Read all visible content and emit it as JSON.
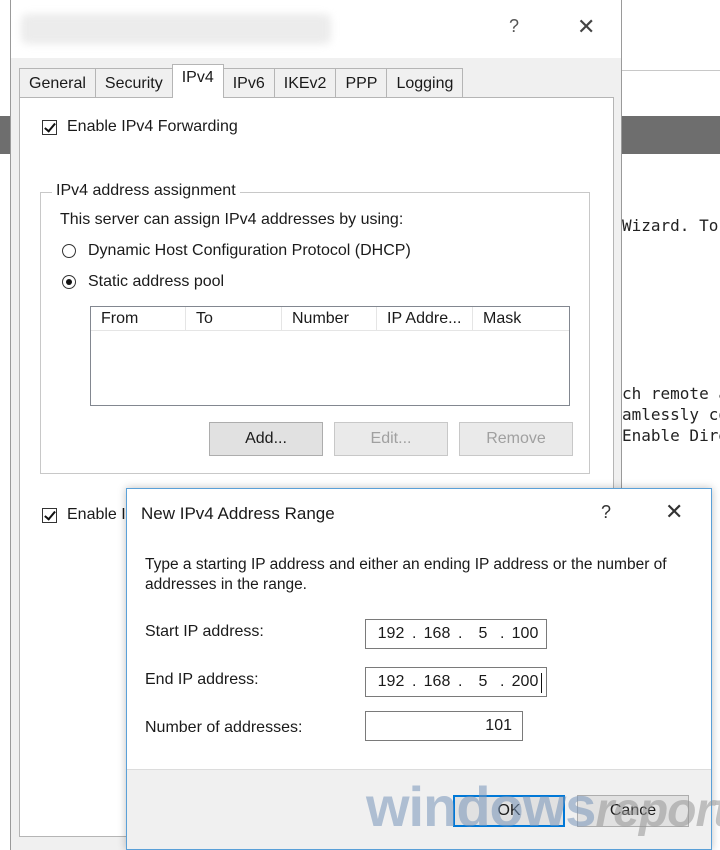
{
  "background_window": {
    "lines": [
      "Wizard. To",
      "ch remote a",
      "amlessly co",
      "Enable Dire"
    ]
  },
  "properties_dialog": {
    "help_glyph": "?",
    "close_glyph": "✕",
    "tabs": [
      "General",
      "Security",
      "IPv4",
      "IPv6",
      "IKEv2",
      "PPP",
      "Logging"
    ],
    "active_tab": "IPv4",
    "enable_forwarding": {
      "label": "Enable IPv4 Forwarding",
      "checked": true
    },
    "address_assignment": {
      "legend": "IPv4 address assignment",
      "description": "This server can assign IPv4 addresses by using:",
      "options": [
        {
          "label": "Dynamic Host Configuration Protocol (DHCP)",
          "selected": false
        },
        {
          "label": "Static address pool",
          "selected": true
        }
      ],
      "columns": [
        "From",
        "To",
        "Number",
        "IP Addre...",
        "Mask"
      ],
      "rows": [],
      "buttons": {
        "add": "Add...",
        "edit": "Edit...",
        "remove": "Remove"
      }
    },
    "second_checkbox": {
      "label": "Enable I",
      "checked": true
    }
  },
  "range_dialog": {
    "title": "New IPv4 Address Range",
    "help_glyph": "?",
    "close_glyph": "✕",
    "description": "Type a starting IP address and either an ending IP address or the number of addresses in the range.",
    "start_label": "Start IP address:",
    "start_ip": [
      "192",
      "168",
      "5",
      "100"
    ],
    "end_label": "End IP address:",
    "end_ip": [
      "192",
      "168",
      "5",
      "200"
    ],
    "count_label": "Number of addresses:",
    "count_value": "101",
    "ok_label": "OK",
    "cancel_label": "Cance"
  },
  "watermark": {
    "part1": "windows",
    "part2": "report"
  }
}
